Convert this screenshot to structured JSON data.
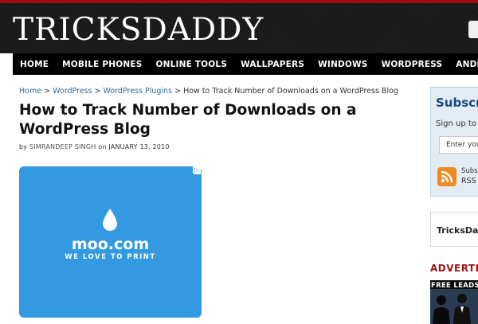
{
  "site": {
    "logo": "TRICKSDADDY"
  },
  "nav": {
    "items": [
      "HOME",
      "MOBILE PHONES",
      "ONLINE TOOLS",
      "WALLPAPERS",
      "WINDOWS",
      "WORDPRESS",
      "ANDROID"
    ]
  },
  "breadcrumb": {
    "home": "Home",
    "sep": ">",
    "wordpress": "WordPress",
    "plugins": "WordPress Plugins",
    "current": "How to Track Number of Downloads on a WordPress Blog"
  },
  "post": {
    "title": "How to Track Number of Downloads on a WordPress Blog",
    "by": "by",
    "author": "SIMRANDEEP SINGH",
    "on": "on",
    "date": "JANUARY 13, 2010"
  },
  "ad": {
    "brand": "moo.com",
    "tagline": "WE LOVE TO PRINT",
    "choices_icon": "adchoices-icon",
    "color": "#3399e0"
  },
  "sidebar": {
    "subscribe": {
      "title": "Subscri",
      "text": "Sign up to r",
      "input_value": "Enter you",
      "rss_sub": "Subsc",
      "rss_label": "RSS"
    },
    "tricksdaddy_box": "TricksDad",
    "advert_title": "ADVERTIS",
    "leads_ad_text": "FREE LEADS FREE"
  },
  "colors": {
    "accent_red": "#9b0f0f",
    "nav_bg": "#000000",
    "link": "#2a6ea5",
    "subscribe_title": "#174a78"
  }
}
